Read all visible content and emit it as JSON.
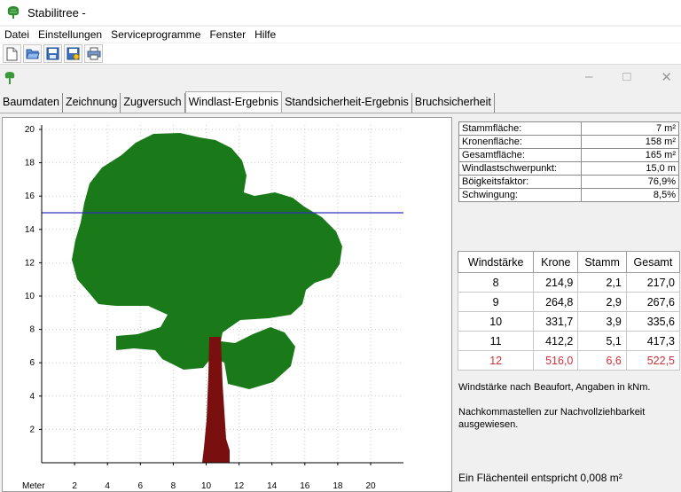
{
  "window": {
    "title": "Stabilitree -",
    "app_icon": "tree-icon"
  },
  "menu": [
    "Datei",
    "Einstellungen",
    "Serviceprogramme",
    "Fenster",
    "Hilfe"
  ],
  "toolbar": [
    "new-document-icon",
    "open-folder-icon",
    "save-icon",
    "save-as-icon",
    "print-icon"
  ],
  "mdi": {
    "controls": [
      "–",
      "□",
      "✕"
    ]
  },
  "tabs": [
    "Baumdaten",
    "Zeichnung",
    "Zugversuch",
    "Windlast-Ergebnis",
    "Standsicherheit-Ergebnis",
    "Bruchsicherheit"
  ],
  "active_tab": 3,
  "chart": {
    "x_unit_label": "Meter",
    "x_ticks": [
      "2",
      "4",
      "6",
      "8",
      "10",
      "12",
      "14",
      "16",
      "18",
      "20"
    ],
    "y_ticks": [
      "2",
      "4",
      "6",
      "8",
      "10",
      "12",
      "14",
      "16",
      "18",
      "20"
    ],
    "wind_center_height": 15.0,
    "colors": {
      "crown": "#1a7a1a",
      "trunk": "#7a0f0f",
      "line": "#3030c0",
      "grid": "#c8c8c8"
    }
  },
  "chart_data": {
    "type": "scatter",
    "xlabel": "Meter",
    "xlim": [
      0,
      22
    ],
    "ylim": [
      0,
      21
    ],
    "grid": true,
    "annotations": [
      {
        "type": "horizontal-line",
        "y": 15.0
      }
    ]
  },
  "info": [
    {
      "label": "Stammfläche:",
      "value": "7 m²"
    },
    {
      "label": "Kronenfläche:",
      "value": "158 m²"
    },
    {
      "label": "Gesamtfläche:",
      "value": "165 m²"
    },
    {
      "label": "Windlastschwerpunkt:",
      "value": "15,0 m"
    },
    {
      "label": "Böigkeitsfaktor:",
      "value": "76,9%"
    },
    {
      "label": "Schwingung:",
      "value": "8,5%"
    }
  ],
  "wind_table": {
    "headers": [
      "Windstärke",
      "Krone",
      "Stamm",
      "Gesamt"
    ],
    "rows": [
      [
        "8",
        "214,9",
        "2,1",
        "217,0"
      ],
      [
        "9",
        "264,8",
        "2,9",
        "267,6"
      ],
      [
        "10",
        "331,7",
        "3,9",
        "335,6"
      ],
      [
        "11",
        "412,2",
        "5,1",
        "417,3"
      ],
      [
        "12",
        "516,0",
        "6,6",
        "522,5"
      ]
    ],
    "highlight_row": 4,
    "highlight_color": "#d0303a"
  },
  "notes": {
    "units": "Windstärke nach Beaufort,   Angaben in kNm.",
    "decimals": "Nachkommastellen zur Nachvollziehbarkeit ausgewiesen.",
    "area": "Ein Flächenteil entspricht 0,008 m²"
  }
}
